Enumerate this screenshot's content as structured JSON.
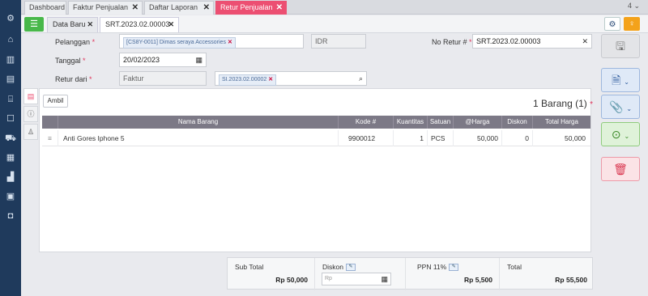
{
  "tabs": [
    {
      "label": "Dashboard"
    },
    {
      "label": "Faktur Penjualan"
    },
    {
      "label": "Daftar Laporan"
    },
    {
      "label": "Retur Penjualan"
    }
  ],
  "tab_count": "4",
  "subtabs": [
    {
      "label": "Data Baru"
    },
    {
      "label": "SRT.2023.02.00003"
    }
  ],
  "form": {
    "pelanggan_label": "Pelanggan",
    "pelanggan_chip": "[CS8Y-0011] Dimas seraya Accessories",
    "currency": "IDR",
    "no_retur_label": "No Retur #",
    "no_retur_value": "SRT.2023.02.00003",
    "tanggal_label": "Tanggal",
    "tanggal_value": "20/02/2023",
    "retur_dari_label": "Retur dari",
    "retur_dari_value": "Faktur",
    "faktur_chip": "SI.2023.02.00002",
    "required_mark": "*"
  },
  "detail": {
    "ambil_label": "Ambil",
    "count_title": "1 Barang (1)",
    "columns": [
      "Nama Barang",
      "Kode #",
      "Kuantitas",
      "Satuan",
      "@Harga",
      "Diskon",
      "Total Harga"
    ],
    "rows": [
      {
        "handle": "≡",
        "nama": "Anti Gores Iphone 5",
        "kode": "9900012",
        "qty": "1",
        "satuan": "PCS",
        "harga": "50,000",
        "diskon": "0",
        "total": "50,000"
      }
    ]
  },
  "summary": {
    "subtotal_label": "Sub Total",
    "subtotal_value": "Rp 50,000",
    "diskon_label": "Diskon",
    "diskon_placeholder": "Rp",
    "ppn_label": "PPN 11%",
    "ppn_value": "Rp 5,500",
    "total_label": "Total",
    "total_value": "Rp 55,500"
  },
  "colors": {
    "active_tab": "#ec4f72",
    "sidebar": "#1f3a5c",
    "add_button": "#48b84a",
    "lightbulb_button": "#f4a21a"
  }
}
